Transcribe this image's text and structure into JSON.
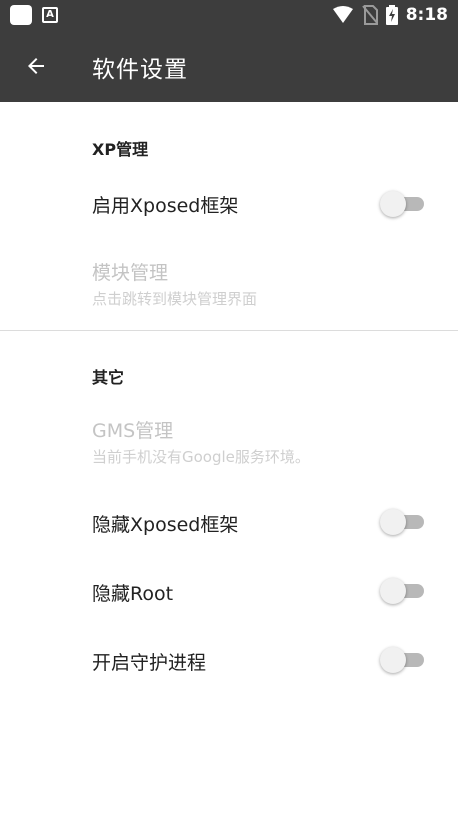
{
  "status_bar": {
    "time": "8:18"
  },
  "app_bar": {
    "title": "软件设置",
    "back_icon": "arrow-left-icon"
  },
  "sections": [
    {
      "header": "XP管理",
      "items": [
        {
          "title": "启用Xposed框架",
          "type": "switch",
          "checked": false,
          "enabled": true
        },
        {
          "title": "模块管理",
          "summary": "点击跳转到模块管理界面",
          "type": "link",
          "enabled": false
        }
      ]
    },
    {
      "header": "其它",
      "items": [
        {
          "title": "GMS管理",
          "summary": "当前手机没有Google服务环境。",
          "type": "link",
          "enabled": false
        },
        {
          "title": "隐藏Xposed框架",
          "type": "switch",
          "checked": false,
          "enabled": true
        },
        {
          "title": "隐藏Root",
          "type": "switch",
          "checked": false,
          "enabled": true
        },
        {
          "title": "开启守护进程",
          "type": "switch",
          "checked": false,
          "enabled": true
        }
      ]
    }
  ],
  "colors": {
    "app_bar": "#3d3d3d",
    "text_primary": "#222222",
    "text_disabled": "#c4c4c4",
    "switch_track_off": "#b8b8b8",
    "switch_thumb_off": "#f1f1f1"
  }
}
